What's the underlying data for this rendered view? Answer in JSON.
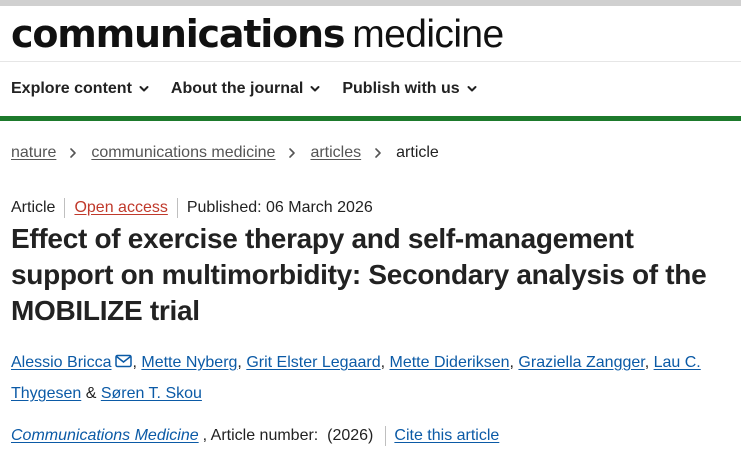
{
  "logo": {
    "bold": "communications",
    "light": "medicine"
  },
  "nav": [
    {
      "label": "Explore content"
    },
    {
      "label": "About the journal"
    },
    {
      "label": "Publish with us"
    }
  ],
  "breadcrumb": {
    "items": [
      "nature",
      "communications medicine",
      "articles"
    ],
    "current": "article"
  },
  "meta": {
    "type": "Article",
    "access": "Open access",
    "published": "Published: 06 March 2026"
  },
  "title": "Effect of exercise therapy and self-management support on multimorbidity: Secondary analysis of the MOBILIZE trial",
  "authors": [
    "Alessio Bricca",
    "Mette Nyberg",
    "Grit Elster Legaard",
    "Mette Dideriksen",
    "Graziella Zangger",
    "Lau C. Thygesen",
    "Søren T. Skou"
  ],
  "journal_line": {
    "journal": "Communications Medicine",
    "article_number": ", Article number:  (2026)",
    "cite": "Cite this article"
  },
  "colors": {
    "accent_green": "#1d7a2c",
    "link_blue": "#0b5aa6",
    "open_access": "#c0392b"
  }
}
